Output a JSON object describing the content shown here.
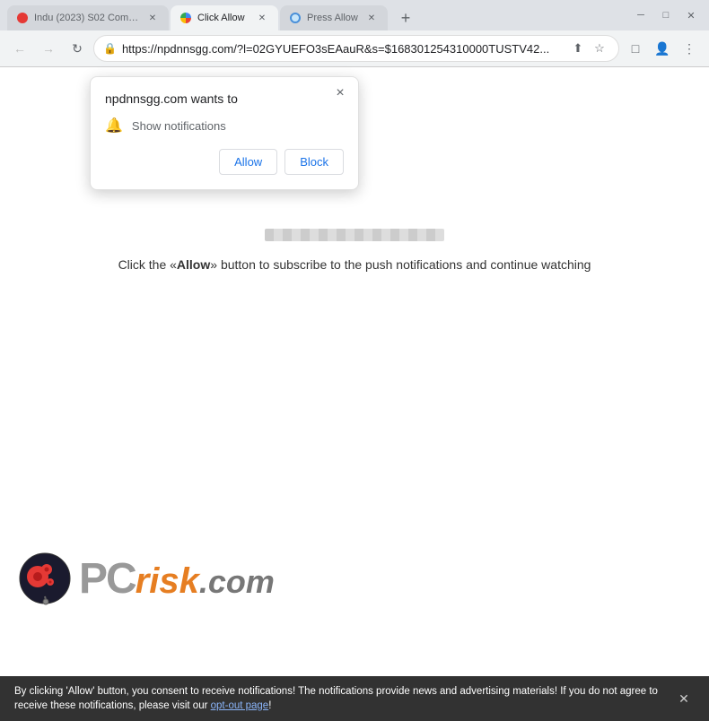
{
  "browser": {
    "tabs": [
      {
        "id": "tab1",
        "title": "Indu (2023) S02 Comp...",
        "favicon_type": "red",
        "active": false
      },
      {
        "id": "tab2",
        "title": "Click Allow",
        "favicon_type": "blue",
        "active": true
      },
      {
        "id": "tab3",
        "title": "Press Allow",
        "favicon_type": "globe",
        "active": false
      }
    ],
    "new_tab_label": "+",
    "window_controls": {
      "minimize": "─",
      "maximize": "□",
      "close": "✕"
    },
    "nav": {
      "back": "←",
      "forward": "→",
      "reload": "↻",
      "address": "https://npdnnsgg.com/?l=02GYUEFO3sEAauR&s=$168301254310000TUSTV42...",
      "share": "⬆",
      "bookmark": "☆",
      "extensions": "□",
      "profile": "👤",
      "menu": "⋮"
    }
  },
  "popup": {
    "title": "npdnnsgg.com wants to",
    "permission_label": "Show notifications",
    "allow_label": "Allow",
    "block_label": "Block",
    "close_symbol": "×"
  },
  "page": {
    "progress_bar_visible": true,
    "instruction_text": "Click the «Allow» button to subscribe to the push notifications and continue watching",
    "instruction_allow_word": "Allow"
  },
  "logo": {
    "pc_text": "PC",
    "risk_text": "risk",
    "dotcom_text": ".com"
  },
  "bottom_bar": {
    "message": "By clicking 'Allow' button, you consent to receive notifications! The notifications provide news and advertising materials! If you do not agree to receive these notifications, please visit our ",
    "link_text": "opt-out page",
    "message_end": "!",
    "close_symbol": "✕"
  }
}
